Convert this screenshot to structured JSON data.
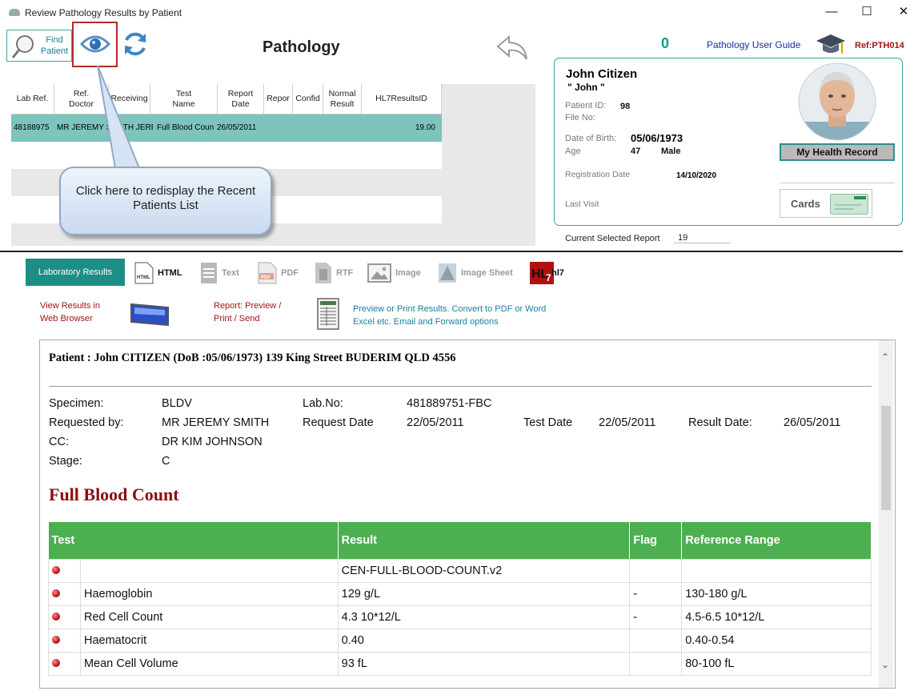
{
  "window": {
    "title": "Review Pathology Results by Patient"
  },
  "toolbar": {
    "find_label": "Find Patient",
    "page_title": "Pathology",
    "count": "0",
    "guide_label": "Pathology User Guide",
    "ref": "Ref:PTH014"
  },
  "grid": {
    "columns": [
      "Lab Ref.",
      "Ref.\nDoctor",
      "Receiving",
      "Test\nName",
      "Report\nDate",
      "Repor",
      "Confid",
      "Normal\nResult",
      "HL7ResultsID"
    ],
    "row": {
      "lab_ref": "48188975",
      "ref_doctor": "MR JEREMY S",
      "receiving": "SMITH JEREM",
      "test_name": "Full Blood Coun",
      "report_date": "26/05/2011",
      "hl7_id": "19.00"
    }
  },
  "callout": {
    "text": "Click here to redisplay the Recent Patients List"
  },
  "patient": {
    "name": "John Citizen",
    "nickname": "\" John \"",
    "patient_id_label": "Patient ID:",
    "patient_id": "98",
    "file_no_label": "File No:",
    "dob_label": "Date of Birth:",
    "dob": "05/06/1973",
    "age_label": "Age",
    "age": "47",
    "sex": "Male",
    "reg_label": "Registration Date",
    "reg_date": "14/10/2020",
    "last_visit_label": "Last Visit",
    "mhr_label": "My Health Record",
    "cards_label": "Cards"
  },
  "current_report": {
    "label": "Current Selected Report",
    "value": "19"
  },
  "tabs": {
    "lab_results": "Laboratory Results",
    "formats": [
      "HTML",
      "Text",
      "PDF",
      "RTF",
      "Image",
      "Image Sheet",
      "hl7"
    ]
  },
  "actions": {
    "view_browser": "View Results in\nWeb Browser",
    "report_preview": "Report:  Preview /\nPrint / Send",
    "preview_desc_1": "Preview or Print Results. Convert to PDF or Word",
    "preview_desc_2": "Excel etc. Email and Forward options"
  },
  "report": {
    "patient_line": "Patient : John CITIZEN (DoB :05/06/1973) 139 King Street BUDERIM QLD 4556",
    "specimen_label": "Specimen:",
    "specimen": "BLDV",
    "labno_label": "Lab.No:",
    "labno": "481889751-FBC",
    "requested_label": "Requested by:",
    "requested": "MR JEREMY SMITH",
    "reqdate_label": "Request Date",
    "reqdate": "22/05/2011",
    "testdate_label": "Test Date",
    "testdate": "22/05/2011",
    "resultdate_label": "Result Date:",
    "resultdate": "26/05/2011",
    "cc_label": "CC:",
    "cc": "DR KIM JOHNSON",
    "stage_label": "Stage:",
    "stage": "C",
    "section_title": "Full Blood Count",
    "table_headers": [
      "Test",
      "Result",
      "Flag",
      "Reference Range"
    ],
    "rows": [
      {
        "test": "",
        "result": "CEN-FULL-BLOOD-COUNT.v2",
        "flag": "",
        "range": ""
      },
      {
        "test": "Haemoglobin",
        "result": "129 g/L",
        "flag": "-",
        "range": "130-180 g/L"
      },
      {
        "test": "Red Cell Count",
        "result": "4.3 10*12/L",
        "flag": "-",
        "range": "4.5-6.5 10*12/L"
      },
      {
        "test": "Haematocrit",
        "result": "0.40",
        "flag": "",
        "range": "0.40-0.54"
      },
      {
        "test": "Mean Cell Volume",
        "result": "93 fL",
        "flag": "",
        "range": "80-100 fL"
      }
    ]
  }
}
